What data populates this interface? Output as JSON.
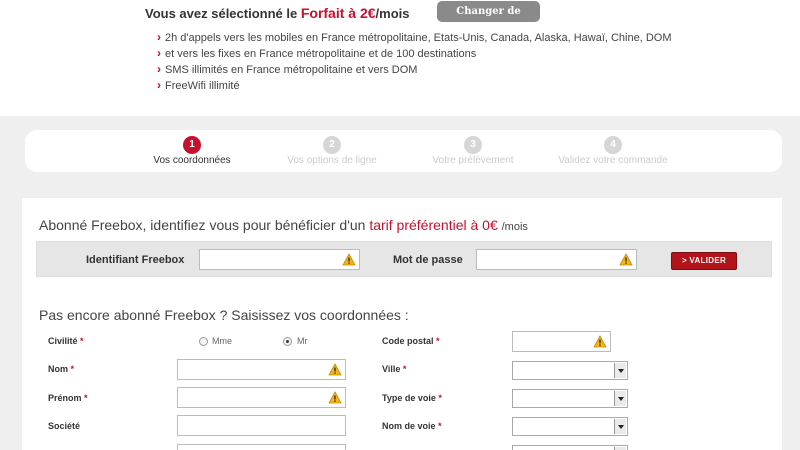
{
  "plan": {
    "prefix": "Vous avez sélectionné le",
    "name": "Forfait à 2€",
    "suffix": "/mois",
    "change_button": "Changer de forfait",
    "features": [
      "2h d'appels vers les mobiles en France métropolitaine, Etats-Unis, Canada, Alaska, Hawaï, Chine, DOM",
      "et vers les fixes en France métropolitaine et de 100 destinations",
      "SMS illimités en France métropolitaine et vers DOM",
      "FreeWifi illimité"
    ]
  },
  "steps": [
    {
      "num": "1",
      "label": "Vos coordonnées",
      "active": true
    },
    {
      "num": "2",
      "label": "Vos options de ligne",
      "active": false
    },
    {
      "num": "3",
      "label": "Votre prélèvement",
      "active": false
    },
    {
      "num": "4",
      "label": "Validez votre commande",
      "active": false
    }
  ],
  "freebox_login": {
    "title_prefix": "Abonné Freebox, identifiez vous pour bénéficier d'un",
    "title_highlight": "tarif préférentiel à 0€",
    "title_suffix": "/mois",
    "id_label": "Identifiant Freebox",
    "id_value": "",
    "password_label": "Mot de passe",
    "password_value": "",
    "submit_label": "> VALIDER"
  },
  "new_customer": {
    "title": "Pas encore abonné Freebox ? Saisissez vos coordonnées :",
    "civilite_label": "Civilité",
    "option_mme": "Mme",
    "option_mr": "Mr",
    "selected": "Mr",
    "nom_label": "Nom",
    "prenom_label": "Prénom",
    "societe_label": "Société",
    "code_postal_label": "Code postal",
    "ville_label": "Ville",
    "type_voie_label": "Type de voie",
    "nom_voie_label": "Nom de voie",
    "required_mark": "*"
  },
  "colors": {
    "accent": "#c8102e",
    "button_grey": "#8a8a8a",
    "background": "#efefef"
  },
  "icons": {
    "warning": "warning-icon",
    "dropdown": "chevron-down-icon"
  }
}
